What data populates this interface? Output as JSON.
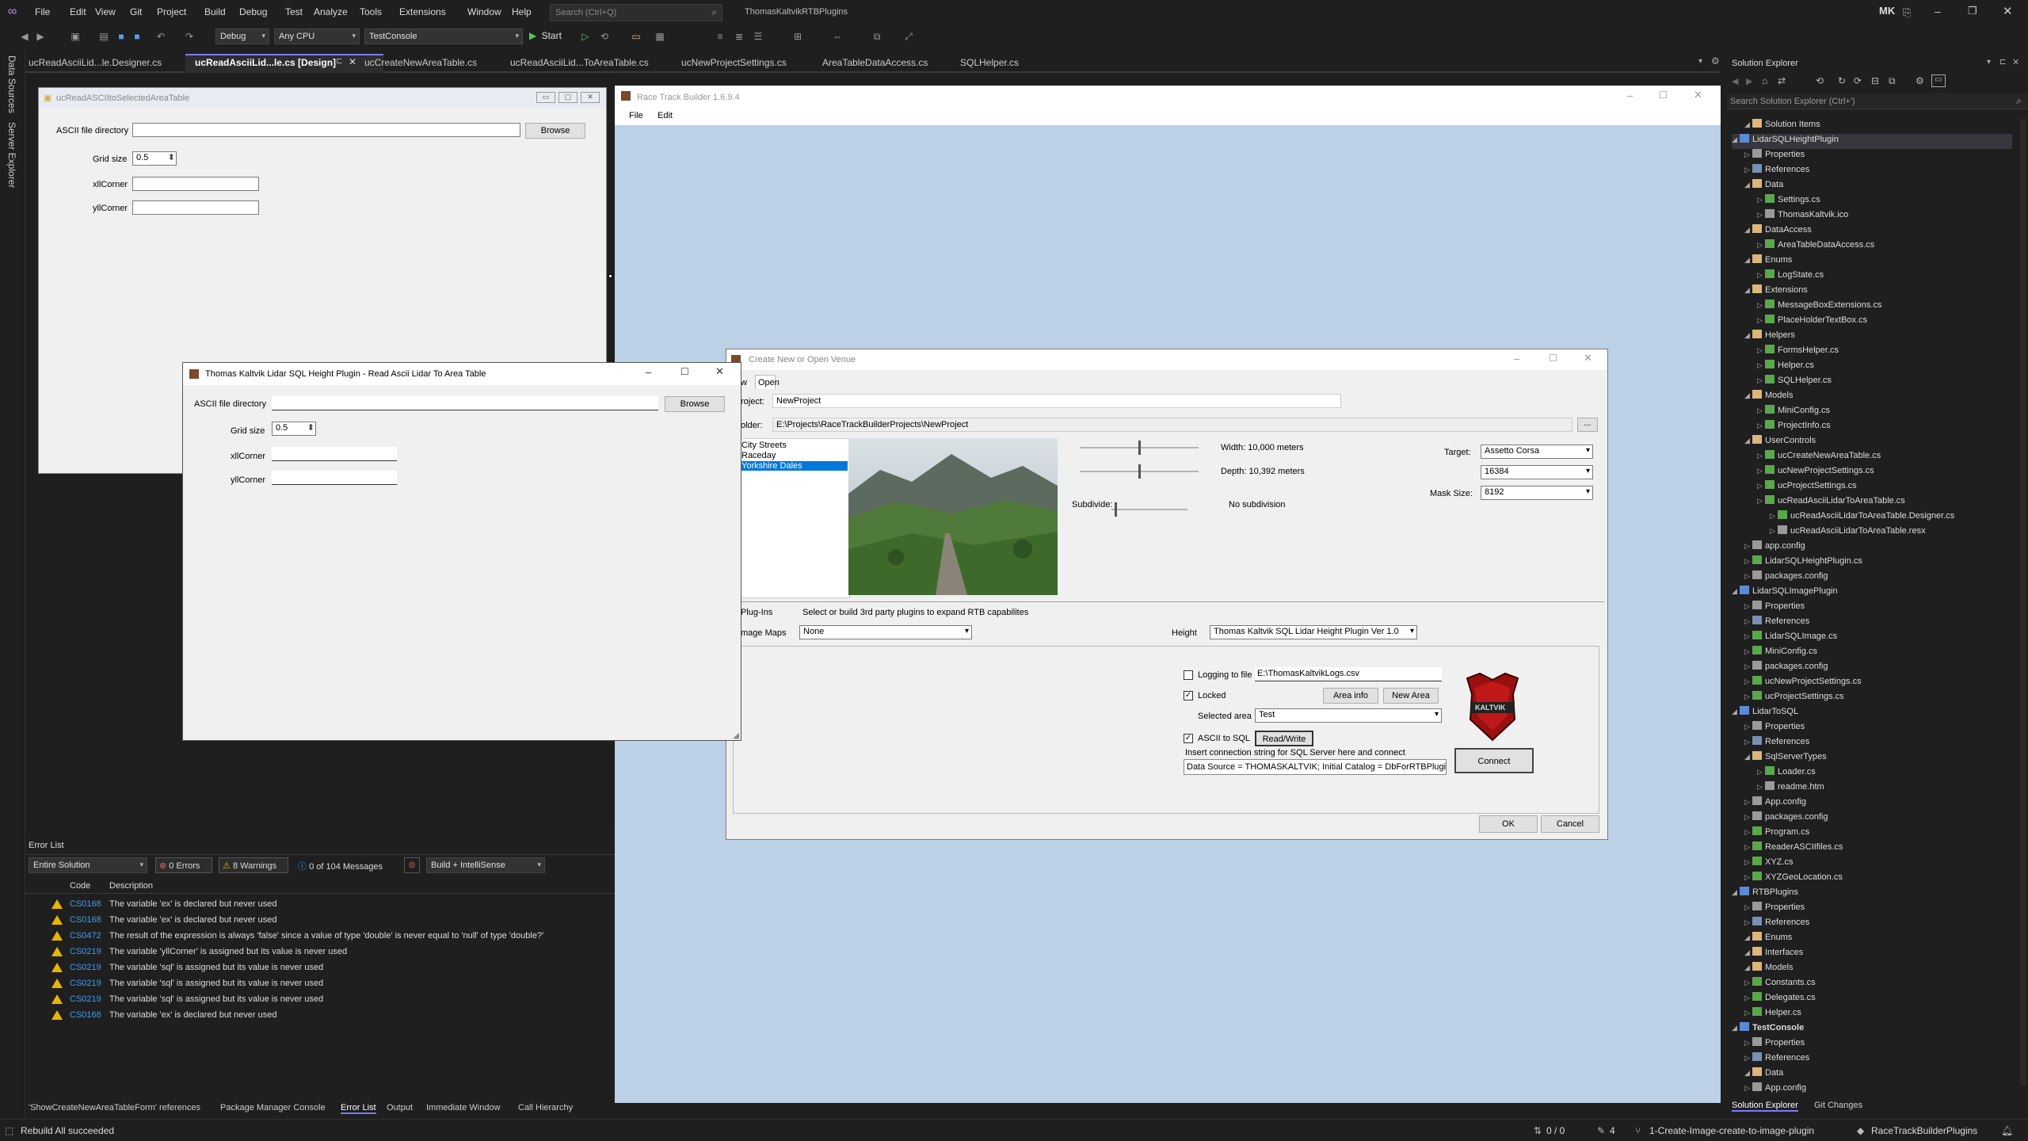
{
  "ide": {
    "menu": [
      "File",
      "Edit",
      "View",
      "Git",
      "Project",
      "Build",
      "Debug",
      "Test",
      "Analyze",
      "Tools",
      "Extensions",
      "Window",
      "Help"
    ],
    "search_placeholder": "Search (Ctrl+Q)",
    "solution_name": "ThomasKaltvikRTBPlugins",
    "user_initials": "MK",
    "config": "Debug",
    "platform": "Any CPU",
    "startup_project": "TestConsole",
    "start_label": "Start",
    "left_side_tabs": [
      "Data Sources",
      "Server Explorer"
    ]
  },
  "doc_tabs": [
    {
      "label": "ucReadAsciiLid...le.Designer.cs"
    },
    {
      "label": "ucReadAsciiLid...le.cs [Design]"
    },
    {
      "label": "ucCreateNewAreaTable.cs"
    },
    {
      "label": "ucReadAsciiLid...ToAreaTable.cs"
    },
    {
      "label": "ucNewProjectSettings.cs"
    },
    {
      "label": "AreaTableDataAccess.cs"
    },
    {
      "label": "SQLHelper.cs"
    }
  ],
  "designer_form": {
    "title": "ucReadASCIItoSelectedAreaTable",
    "ascii_label": "ASCII file directory",
    "browse": "Browse",
    "grid_label": "Grid size",
    "grid_value": "0.5",
    "xll_label": "xllCorner",
    "yll_label": "yllCorner"
  },
  "float_dialog": {
    "title": "Thomas Kaltvik Lidar SQL Height Plugin - Read Ascii Lidar To Area Table",
    "ascii_label": "ASCII file directory",
    "browse": "Browse",
    "grid_label": "Grid size",
    "grid_value": "0.5",
    "xll_label": "xllCorner",
    "yll_label": "yllCorner"
  },
  "error_list": {
    "title": "Error List",
    "scope": "Entire Solution",
    "errors": "0 Errors",
    "warnings": "8 Warnings",
    "messages": "0 of 104 Messages",
    "build_filter": "Build + IntelliSense",
    "col_code": "Code",
    "col_desc": "Description",
    "rows": [
      {
        "code": "CS0168",
        "desc": "The variable 'ex' is declared but never used"
      },
      {
        "code": "CS0168",
        "desc": "The variable 'ex' is declared but never used"
      },
      {
        "code": "CS0472",
        "desc": "The result of the expression is always 'false' since a value of type 'double' is never equal to 'null' of type 'double?'"
      },
      {
        "code": "CS0219",
        "desc": "The variable 'yllCorner' is assigned but its value is never used"
      },
      {
        "code": "CS0219",
        "desc": "The variable 'sql' is assigned but its value is never used"
      },
      {
        "code": "CS0219",
        "desc": "The variable 'sql' is assigned but its value is never used"
      },
      {
        "code": "CS0219",
        "desc": "The variable 'sql' is assigned but its value is never used"
      },
      {
        "code": "CS0168",
        "desc": "The variable 'ex' is declared but never used"
      }
    ]
  },
  "bottom_tabs": [
    "'ShowCreateNewAreaTableForm' references",
    "Package Manager Console",
    "Error List",
    "Output",
    "Immediate Window",
    "Call Hierarchy"
  ],
  "rtb": {
    "title": "Race Track Builder 1.6.9.4",
    "menu": [
      "File",
      "Edit"
    ]
  },
  "venue": {
    "title": "Create New or Open Venue",
    "tabs": [
      "w",
      "Open"
    ],
    "project_label": "roject:",
    "project_value": "NewProject",
    "folder_label": "older:",
    "folder_value": "E:\\Projects\\RaceTrackBuilderProjects\\NewProject",
    "browse_dots": "...",
    "list": [
      "City Streets",
      "Raceday",
      "Yorkshire Dales"
    ],
    "width_text": "Width: 10,000 meters",
    "depth_text": "Depth: 10,392 meters",
    "subdivide_label": "Subdivide:",
    "subdivide_value": "No subdivision",
    "target_label": "Target:",
    "target_value": "Assetto Corsa",
    "size_value": "16384",
    "mask_label": "Mask Size:",
    "mask_value": "8192",
    "plugins_label": "Plug-Ins",
    "plugins_desc": "Select or build 3rd party plugins to expand RTB capabilites",
    "image_maps_label": "mage Maps",
    "image_maps_value": "None",
    "height_label": "Height",
    "height_value": "Thomas Kaltvik SQL Lidar Height Plugin Ver 1.0",
    "logging_label": "Logging to file",
    "logging_value": "E:\\ThomasKaltvikLogs.csv",
    "locked_label": "Locked",
    "area_info": "Area info",
    "new_area": "New Area",
    "selected_area_label": "Selected area",
    "selected_area_value": "Test",
    "ascii_sql_label": "ASCII to SQL",
    "read_write": "Read/Write",
    "conn_hint": "Insert connection string for SQL Server here and connect",
    "conn_value": "Data Source = THOMASKALTVIK; Initial Catalog = DbForRTBPlugin;",
    "connect": "Connect",
    "ok": "OK",
    "cancel": "Cancel",
    "logo_text": "KALTVIK"
  },
  "solution_explorer": {
    "title": "Solution Explorer",
    "search_placeholder": "Search Solution Explorer (Ctrl+')",
    "items": [
      {
        "t": "Solution Items",
        "d": 2,
        "k": "fold"
      },
      {
        "t": "LidarSQLHeightPlugin",
        "d": 1,
        "k": "proj",
        "sel": true
      },
      {
        "t": "Properties",
        "d": 2,
        "k": "cfg"
      },
      {
        "t": "References",
        "d": 2,
        "k": "refs"
      },
      {
        "t": "Data",
        "d": 2,
        "k": "fold"
      },
      {
        "t": "Settings.cs",
        "d": 3,
        "k": "cs"
      },
      {
        "t": "ThomasKaltvik.ico",
        "d": 3,
        "k": "cfg"
      },
      {
        "t": "DataAccess",
        "d": 2,
        "k": "fold"
      },
      {
        "t": "AreaTableDataAccess.cs",
        "d": 3,
        "k": "cs"
      },
      {
        "t": "Enums",
        "d": 2,
        "k": "fold"
      },
      {
        "t": "LogState.cs",
        "d": 3,
        "k": "cs"
      },
      {
        "t": "Extensions",
        "d": 2,
        "k": "fold"
      },
      {
        "t": "MessageBoxExtensions.cs",
        "d": 3,
        "k": "cs"
      },
      {
        "t": "PlaceHolderTextBox.cs",
        "d": 3,
        "k": "cs"
      },
      {
        "t": "Helpers",
        "d": 2,
        "k": "fold"
      },
      {
        "t": "FormsHelper.cs",
        "d": 3,
        "k": "cs"
      },
      {
        "t": "Helper.cs",
        "d": 3,
        "k": "cs"
      },
      {
        "t": "SQLHelper.cs",
        "d": 3,
        "k": "cs"
      },
      {
        "t": "Models",
        "d": 2,
        "k": "fold"
      },
      {
        "t": "MiniConfig.cs",
        "d": 3,
        "k": "cs"
      },
      {
        "t": "ProjectInfo.cs",
        "d": 3,
        "k": "cs"
      },
      {
        "t": "UserControls",
        "d": 2,
        "k": "fold"
      },
      {
        "t": "ucCreateNewAreaTable.cs",
        "d": 3,
        "k": "cs"
      },
      {
        "t": "ucNewProjectSettings.cs",
        "d": 3,
        "k": "cs"
      },
      {
        "t": "ucProjectSettings.cs",
        "d": 3,
        "k": "cs"
      },
      {
        "t": "ucReadAsciiLidarToAreaTable.cs",
        "d": 3,
        "k": "cs"
      },
      {
        "t": "ucReadAsciiLidarToAreaTable.Designer.cs",
        "d": 4,
        "k": "cs"
      },
      {
        "t": "ucReadAsciiLidarToAreaTable.resx",
        "d": 4,
        "k": "cfg"
      },
      {
        "t": "app.config",
        "d": 2,
        "k": "cfg"
      },
      {
        "t": "LidarSQLHeightPlugin.cs",
        "d": 2,
        "k": "cs"
      },
      {
        "t": "packages.config",
        "d": 2,
        "k": "cfg"
      },
      {
        "t": "LidarSQLImagePlugin",
        "d": 1,
        "k": "proj"
      },
      {
        "t": "Properties",
        "d": 2,
        "k": "cfg"
      },
      {
        "t": "References",
        "d": 2,
        "k": "refs"
      },
      {
        "t": "LidarSQLImage.cs",
        "d": 2,
        "k": "cs"
      },
      {
        "t": "MiniConfig.cs",
        "d": 2,
        "k": "cs"
      },
      {
        "t": "packages.config",
        "d": 2,
        "k": "cfg"
      },
      {
        "t": "ucNewProjectSettings.cs",
        "d": 2,
        "k": "cs"
      },
      {
        "t": "ucProjectSettings.cs",
        "d": 2,
        "k": "cs"
      },
      {
        "t": "LidarToSQL",
        "d": 1,
        "k": "proj"
      },
      {
        "t": "Properties",
        "d": 2,
        "k": "cfg"
      },
      {
        "t": "References",
        "d": 2,
        "k": "refs"
      },
      {
        "t": "SqlServerTypes",
        "d": 2,
        "k": "fold"
      },
      {
        "t": "Loader.cs",
        "d": 3,
        "k": "cs"
      },
      {
        "t": "readme.htm",
        "d": 3,
        "k": "cfg"
      },
      {
        "t": "App.config",
        "d": 2,
        "k": "cfg"
      },
      {
        "t": "packages.config",
        "d": 2,
        "k": "cfg"
      },
      {
        "t": "Program.cs",
        "d": 2,
        "k": "cs"
      },
      {
        "t": "ReaderASCIIfiles.cs",
        "d": 2,
        "k": "cs"
      },
      {
        "t": "XYZ.cs",
        "d": 2,
        "k": "cs"
      },
      {
        "t": "XYZGeoLocation.cs",
        "d": 2,
        "k": "cs"
      },
      {
        "t": "RTBPlugins",
        "d": 1,
        "k": "proj"
      },
      {
        "t": "Properties",
        "d": 2,
        "k": "cfg"
      },
      {
        "t": "References",
        "d": 2,
        "k": "refs"
      },
      {
        "t": "Enums",
        "d": 2,
        "k": "fold"
      },
      {
        "t": "Interfaces",
        "d": 2,
        "k": "fold"
      },
      {
        "t": "Models",
        "d": 2,
        "k": "fold"
      },
      {
        "t": "Constants.cs",
        "d": 2,
        "k": "cs"
      },
      {
        "t": "Delegates.cs",
        "d": 2,
        "k": "cs"
      },
      {
        "t": "Helper.cs",
        "d": 2,
        "k": "cs"
      },
      {
        "t": "TestConsole",
        "d": 1,
        "k": "proj",
        "bold": true
      },
      {
        "t": "Properties",
        "d": 2,
        "k": "cfg"
      },
      {
        "t": "References",
        "d": 2,
        "k": "refs"
      },
      {
        "t": "Data",
        "d": 2,
        "k": "fold"
      },
      {
        "t": "App.config",
        "d": 2,
        "k": "cfg"
      }
    ],
    "bottom_tabs": [
      "Solution Explorer",
      "Git Changes"
    ]
  },
  "status": {
    "left": "Rebuild All succeeded",
    "arrows": "0 / 0",
    "pencil": "4",
    "branch": "1-Create-Image-create-to-image-plugin",
    "repo": "RaceTrackBuilderPlugins"
  }
}
